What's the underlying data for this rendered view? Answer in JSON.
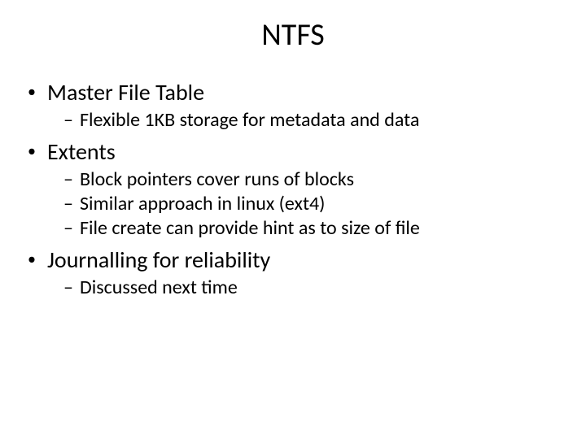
{
  "title": "NTFS",
  "items": [
    {
      "label": "Master File Table",
      "sub": [
        "Flexible 1KB storage for metadata and data"
      ]
    },
    {
      "label": "Extents",
      "sub": [
        "Block pointers cover runs of blocks",
        "Similar approach in linux (ext4)",
        "File create can provide hint as to size of file"
      ]
    },
    {
      "label": "Journalling for reliability",
      "sub": [
        "Discussed next time"
      ]
    }
  ],
  "glyphs": {
    "bullet": "•",
    "dash": "–"
  }
}
